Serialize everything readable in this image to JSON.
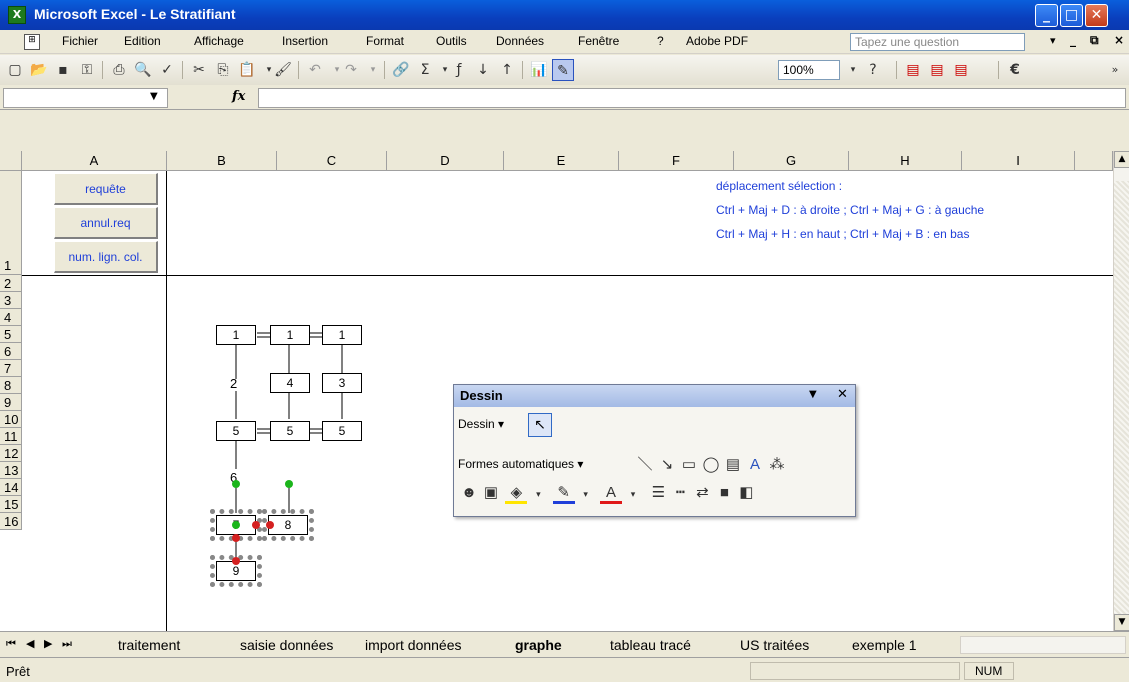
{
  "window": {
    "title": "Microsoft Excel - Le Stratifiant",
    "icon": "excel-icon"
  },
  "menu": {
    "items": [
      "Fichier",
      "Edition",
      "Affichage",
      "Insertion",
      "Format",
      "Outils",
      "Données",
      "Fenêtre",
      "?",
      "Adobe PDF"
    ],
    "question_placeholder": "Tapez une question"
  },
  "toolbar": {
    "zoom": "100%",
    "euro": "€"
  },
  "formula": {
    "fx": "fx",
    "namebox": "",
    "content": ""
  },
  "grid": {
    "columns": [
      "A",
      "B",
      "C",
      "D",
      "E",
      "F",
      "G",
      "H",
      "I"
    ],
    "rows": [
      "1",
      "2",
      "3",
      "4",
      "5",
      "6",
      "7",
      "8",
      "9",
      "10",
      "11",
      "12",
      "13",
      "14",
      "15",
      "16"
    ],
    "buttons": [
      "requête",
      "annul.req",
      "num. lign. col."
    ],
    "info": [
      "déplacement sélection :",
      "Ctrl + Maj + D : à droite ; Ctrl + Maj + G : à gauche",
      "Ctrl + Maj + H : en haut ; Ctrl + Maj + B : en bas"
    ]
  },
  "diagram": {
    "boxes": [
      "1",
      "1",
      "1",
      "4",
      "3",
      "5",
      "5",
      "5",
      "7",
      "8",
      "9"
    ],
    "labels": [
      "2",
      "6"
    ]
  },
  "dessin": {
    "title": "Dessin",
    "menu_label": "Dessin",
    "autoshapes_label": "Formes automatiques"
  },
  "sheets": {
    "tabs": [
      "traitement",
      "saisie données",
      "import données",
      "graphe",
      "tableau tracé",
      "US traitées",
      "exemple 1"
    ],
    "active": "graphe"
  },
  "status": {
    "text": "Prêt",
    "num": "NUM"
  }
}
